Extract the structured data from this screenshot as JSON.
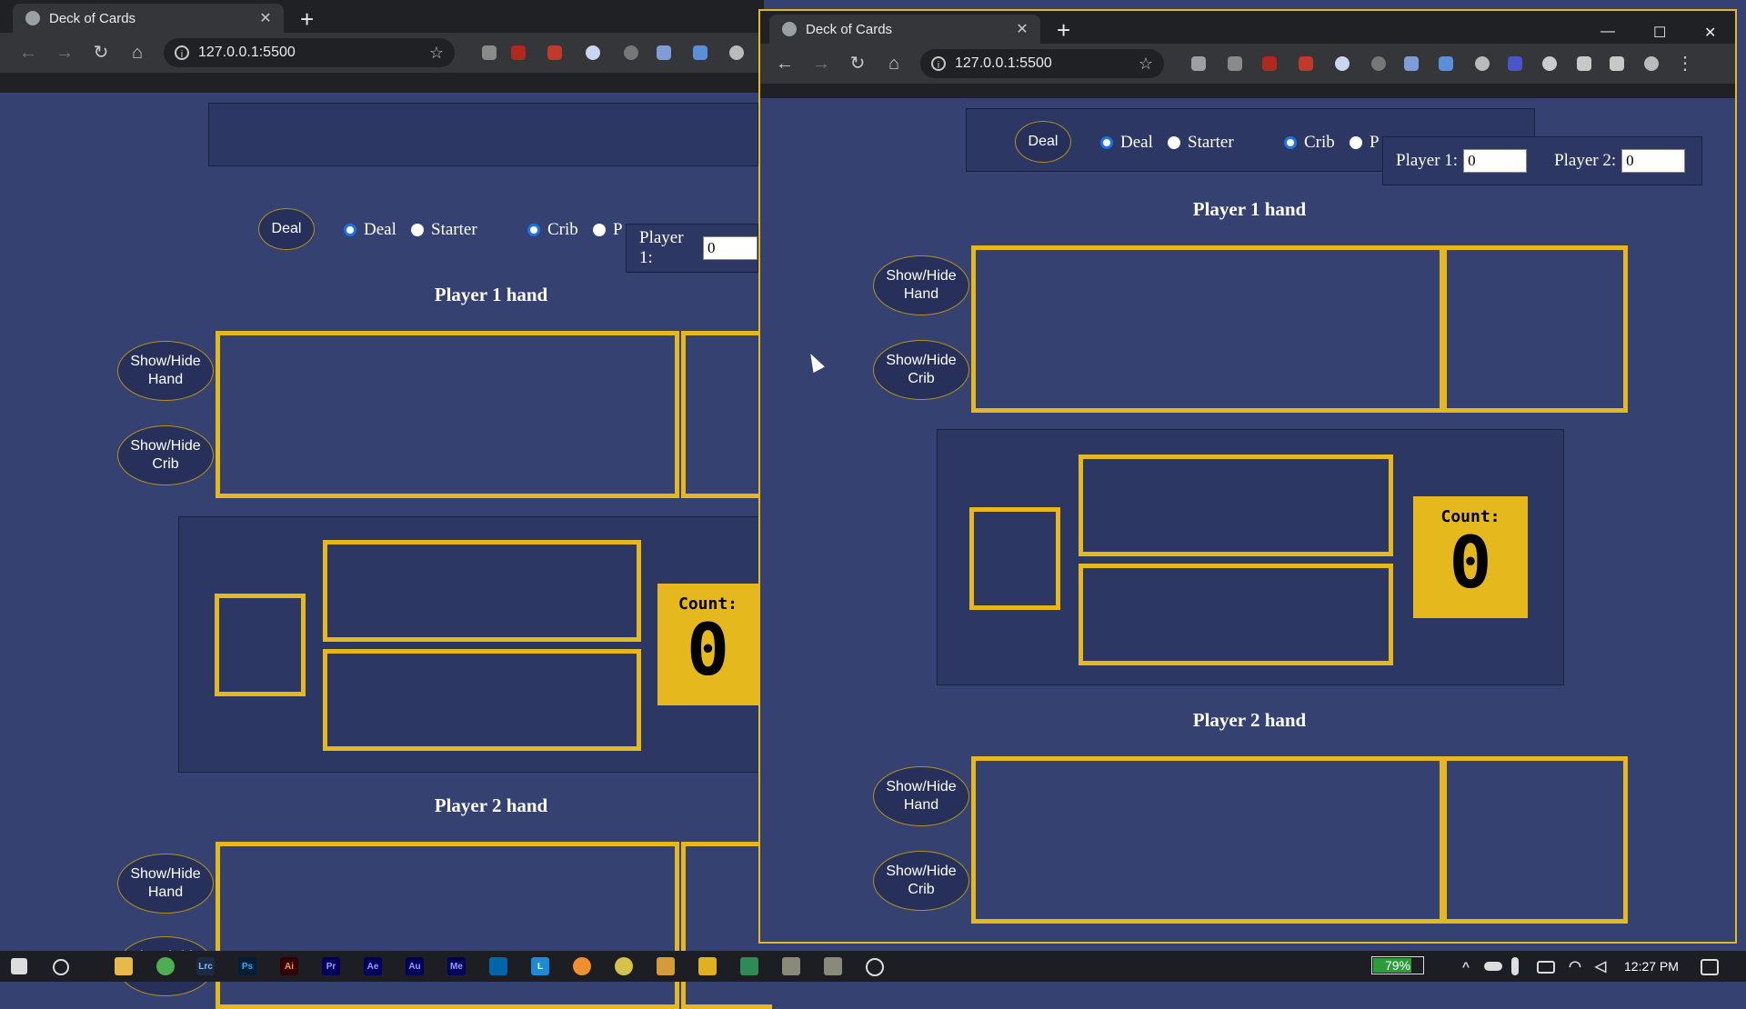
{
  "left_window": {
    "tab_title": "Deck of Cards",
    "url": "127.0.0.1:5500",
    "controls": {
      "deal_button": "Deal",
      "radio_deal": "Deal",
      "radio_starter": "Starter",
      "radio_crib": "Crib",
      "radio_peg_partial": "P",
      "player1_label": "Player 1:",
      "player1_value": "0"
    },
    "player1_hand_title": "Player 1 hand",
    "player2_hand_title": "Player 2 hand",
    "show_hide_hand": "Show/Hide Hand",
    "show_hide_crib": "Show/Hide Crib",
    "count_label": "Count:",
    "count_value": "0"
  },
  "right_window": {
    "tab_title": "Deck of Cards",
    "url": "127.0.0.1:5500",
    "controls": {
      "deal_button": "Deal",
      "radio_deal": "Deal",
      "radio_starter": "Starter",
      "radio_crib": "Crib",
      "radio_peg_partial": "P",
      "player1_label": "Player 1:",
      "player1_value": "0",
      "player2_label": "Player 2:",
      "player2_value": "0"
    },
    "player1_hand_title": "Player 1 hand",
    "player2_hand_title": "Player 2 hand",
    "show_hide_hand": "Show/Hide Hand",
    "show_hide_crib": "Show/Hide Crib",
    "count_label": "Count:",
    "count_value": "0"
  },
  "taskbar": {
    "battery": "79%",
    "battery_level": 0.79,
    "time": "12:27 PM"
  },
  "colors": {
    "page_bg": "#354271",
    "accent_gold": "#e5b81e",
    "chrome_dark": "#202124"
  }
}
